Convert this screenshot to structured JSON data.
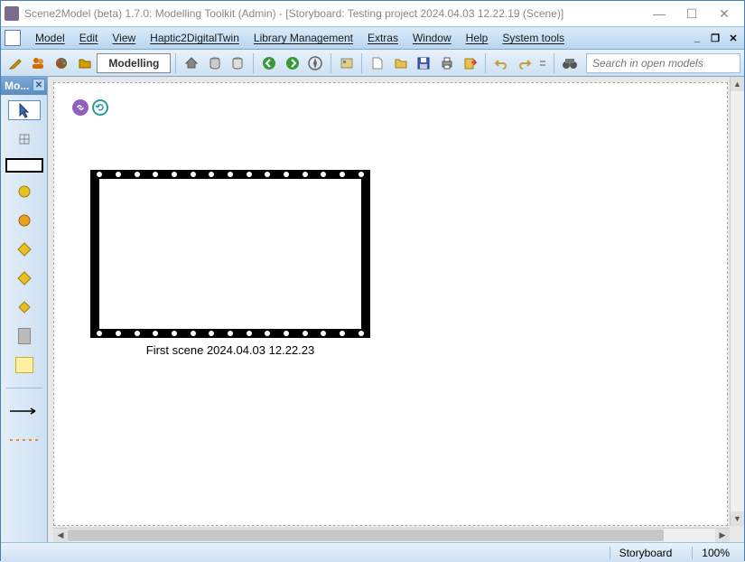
{
  "window": {
    "title": "Scene2Model (beta) 1.7.0: Modelling Toolkit (Admin) - [Storyboard: Testing project 2024.04.03 12.22.19 (Scene)]"
  },
  "menu": {
    "model": "Model",
    "edit": "Edit",
    "view": "View",
    "haptic": "Haptic2DigitalTwin",
    "library": "Library Management",
    "extras": "Extras",
    "window": "Window",
    "help": "Help",
    "system": "System tools"
  },
  "toolbar": {
    "mode_label": "Modelling",
    "search_placeholder": "Search in open models"
  },
  "palette": {
    "tab_label": "Mo..."
  },
  "scene": {
    "caption": "First scene 2024.04.03 12.22.23"
  },
  "status": {
    "type": "Storyboard",
    "zoom": "100%"
  }
}
